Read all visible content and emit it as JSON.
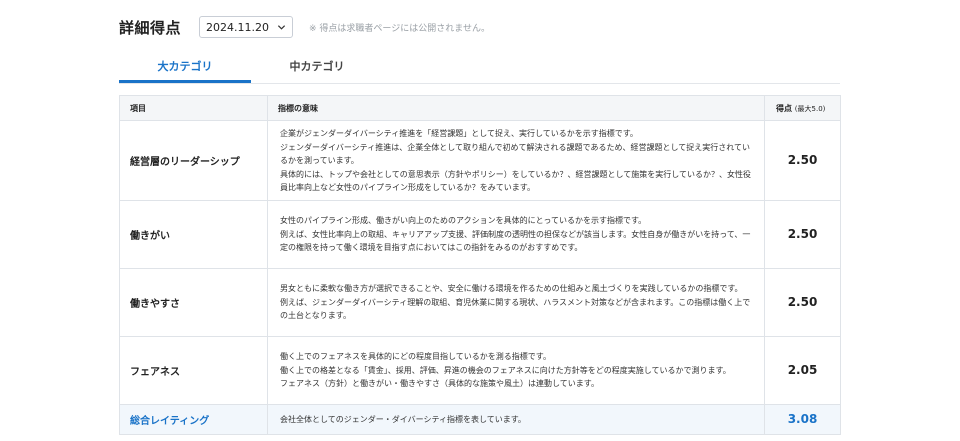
{
  "header": {
    "title": "詳細得点",
    "date_value": "2024.11.20",
    "note": "※ 得点は求職者ページには公開されません。"
  },
  "tabs": [
    {
      "label": "大カテゴリ",
      "active": true
    },
    {
      "label": "中カテゴリ",
      "active": false
    }
  ],
  "table": {
    "headers": {
      "item": "項目",
      "meaning": "指標の意味",
      "score": "得点",
      "score_note": "(最大5.0)"
    },
    "rows": [
      {
        "item": "経営層のリーダーシップ",
        "lines": [
          "企業がジェンダーダイバーシティ推進を「経営課題」として捉え、実行しているかを示す指標です。",
          "ジェンダーダイバーシティ推進は、企業全体として取り組んで初めて解決される課題であるため、経営課題として捉え実行されているかを測っています。",
          "具体的には、トップや会社としての意思表示（方針やポリシー）をしているか？、経営課題として施策を実行しているか？、女性役員比率向上など女性のパイプライン形成をしているか？をみています。"
        ],
        "score": "2.50"
      },
      {
        "item": "働きがい",
        "lines": [
          "女性のパイプライン形成、働きがい向上のためのアクションを具体的にとっているかを示す指標です。",
          "例えば、女性比率向上の取組、キャリアアップ支援、評価制度の透明性の担保などが該当します。女性自身が働きがいを持って、一定の権限を持って働く環境を目指す点においてはこの指針をみるのがおすすめです。"
        ],
        "score": "2.50"
      },
      {
        "item": "働きやすさ",
        "lines": [
          "男女ともに柔軟な働き方が選択できることや、安全に働ける環境を作るための仕組みと風土づくりを実践しているかの指標です。",
          "例えば、ジェンダーダイバーシティ理解の取組、育児休業に関する現状、ハラスメント対策などが含まれます。この指標は働く上での土台となります。"
        ],
        "score": "2.50"
      },
      {
        "item": "フェアネス",
        "lines": [
          "働く上でのフェアネスを具体的にどの程度目指しているかを測る指標です。",
          "働く上での格差となる「賃金」、採用、評価、昇進の機会のフェアネスに向けた方針等をどの程度実施しているかで測ります。",
          "フェアネス（方針）と働きがい・働きやすさ（具体的な施策や風土）は連動しています。"
        ],
        "score": "2.05"
      }
    ],
    "total": {
      "item": "総合レイティング",
      "desc": "会社全体としてのジェンダー・ダイバーシティ指標を表しています。",
      "score": "3.08"
    }
  },
  "colors": {
    "accent": "#1a73c8",
    "border": "#dfe3e8",
    "header_bg": "#f4f6f8",
    "total_bg": "#f2f7fc"
  }
}
